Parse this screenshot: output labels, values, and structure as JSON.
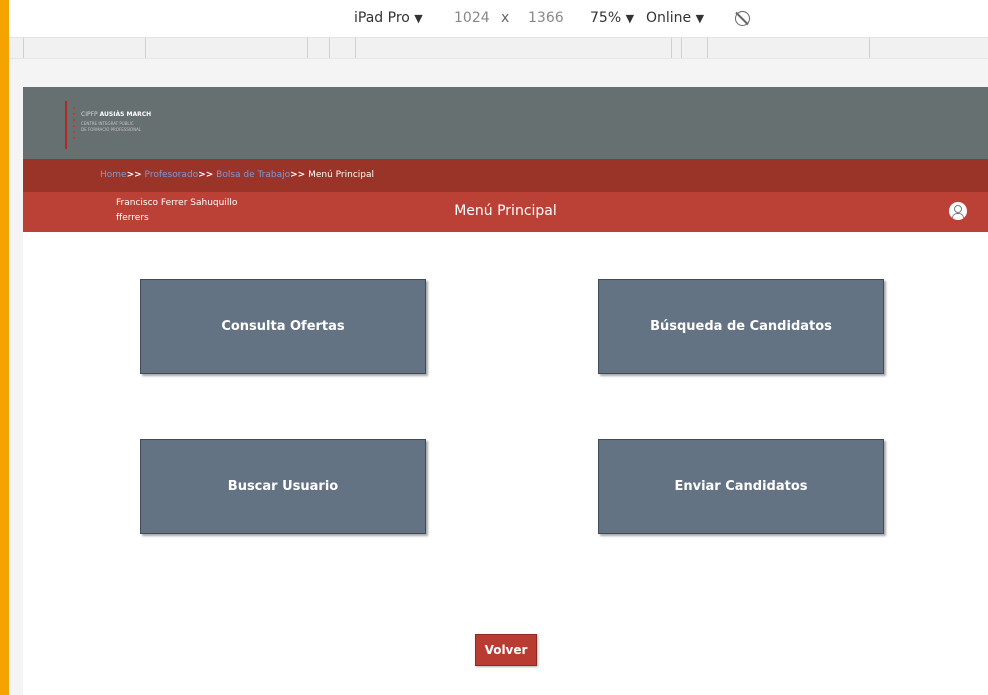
{
  "devtools": {
    "device": "iPad Pro",
    "device_caret": "▼",
    "width": "1024",
    "times": "x",
    "height": "1366",
    "zoom": "75%",
    "zoom_caret": "▼",
    "network": "Online",
    "network_caret": "▼"
  },
  "header": {
    "logo_line1_prefix": "CIPFP",
    "logo_line1_bold": "AUSIÀS MARCH",
    "logo_line2": "CENTRE INTEGRAT PÚBLIC",
    "logo_line3": "DE FORMACIÓ PROFESSIONAL"
  },
  "breadcrumb": {
    "home": "Home",
    "sep1": ">>",
    "profesorado": "Profesorado",
    "sep2": ">>",
    "bolsa": "Bolsa de Trabajo",
    "sep3": ">>",
    "current": "Menú Principal"
  },
  "userbar": {
    "full_name": "Francisco Ferrer Sahuquillo",
    "username": "fferrers",
    "page_title": "Menú Principal",
    "user_icon": "user-circle-icon"
  },
  "menu": {
    "consulta_ofertas": "Consulta Ofertas",
    "busqueda_candidatos": "Búsqueda de Candidatos",
    "buscar_usuario": "Buscar Usuario",
    "enviar_candidatos": "Enviar Candidatos"
  },
  "footer": {
    "volver": "Volver"
  },
  "colors": {
    "header_gray": "#677070",
    "breadcrumb_bg": "#9a3328",
    "userbar_bg": "#bb4136",
    "tile_bg": "#647384",
    "link": "#7d9ad6"
  }
}
